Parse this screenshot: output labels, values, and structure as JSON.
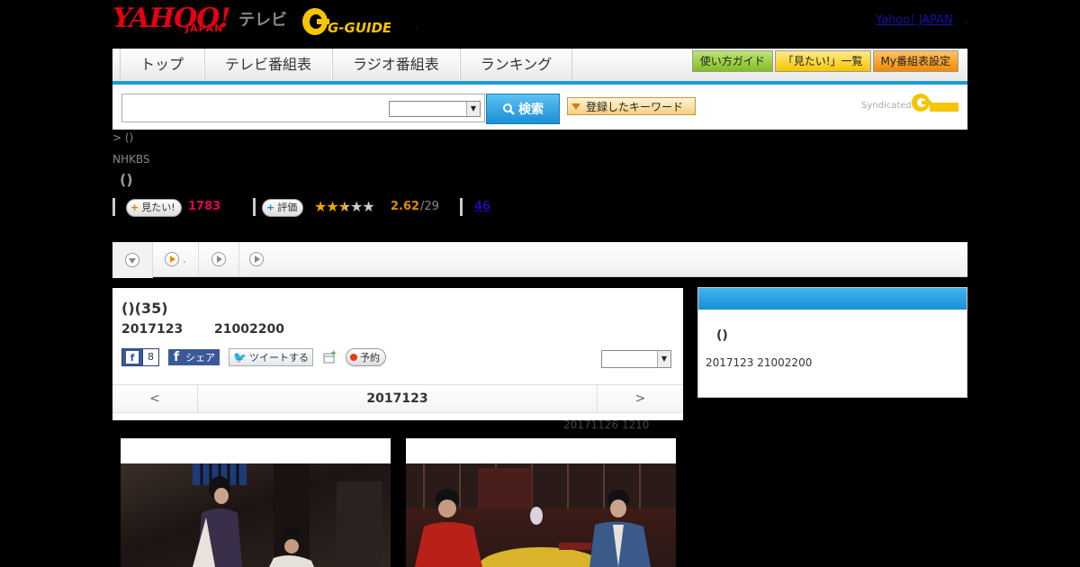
{
  "header": {
    "logo_yahoo": "YAHOO!",
    "logo_japan": "JAPAN",
    "logo_tv": "テレビ",
    "logo_gguide": "G-GUIDE",
    "yahoo_japan_link": "Yahoo! JAPAN",
    "dot_small": ".",
    "dot_right": "."
  },
  "nav": {
    "tabs": [
      "トップ",
      "テレビ番組表",
      "ラジオ番組表",
      "ランキング"
    ],
    "buttons": [
      "使い方ガイド",
      "「見たい!」一覧",
      "My番組表設定"
    ]
  },
  "search": {
    "search_button": "検索",
    "keyword_button": "登録したキーワード",
    "syndicated": "Syndicated"
  },
  "breadcrumb": "> ()",
  "channel": "NHKBS",
  "program_title": "()",
  "stats": {
    "mitai_label": "見たい!",
    "mitai_count": "1783",
    "rating_label": "評価",
    "score": "2.62",
    "score_count": "/29",
    "review_count": "46"
  },
  "tabstrip": {
    "tab2_dot": "."
  },
  "episode": {
    "title": "()(35)",
    "date": "2017123",
    "time": "21002200",
    "fb_like_count": "8",
    "fb_share_label": "シェア",
    "tweet_label": "ツイートする",
    "reserve_label": "予約",
    "pager_prev": "<",
    "pager_date": "2017123",
    "pager_next": ">",
    "update_note": "20171126  1210"
  },
  "sidebar": {
    "title": "()",
    "date": "2017123  21002200"
  },
  "colors": {
    "accent_blue": "#1a9bdc",
    "yahoo_red": "#e60012",
    "mitai_pink": "#e6005c",
    "score_orange": "#e08a00"
  }
}
